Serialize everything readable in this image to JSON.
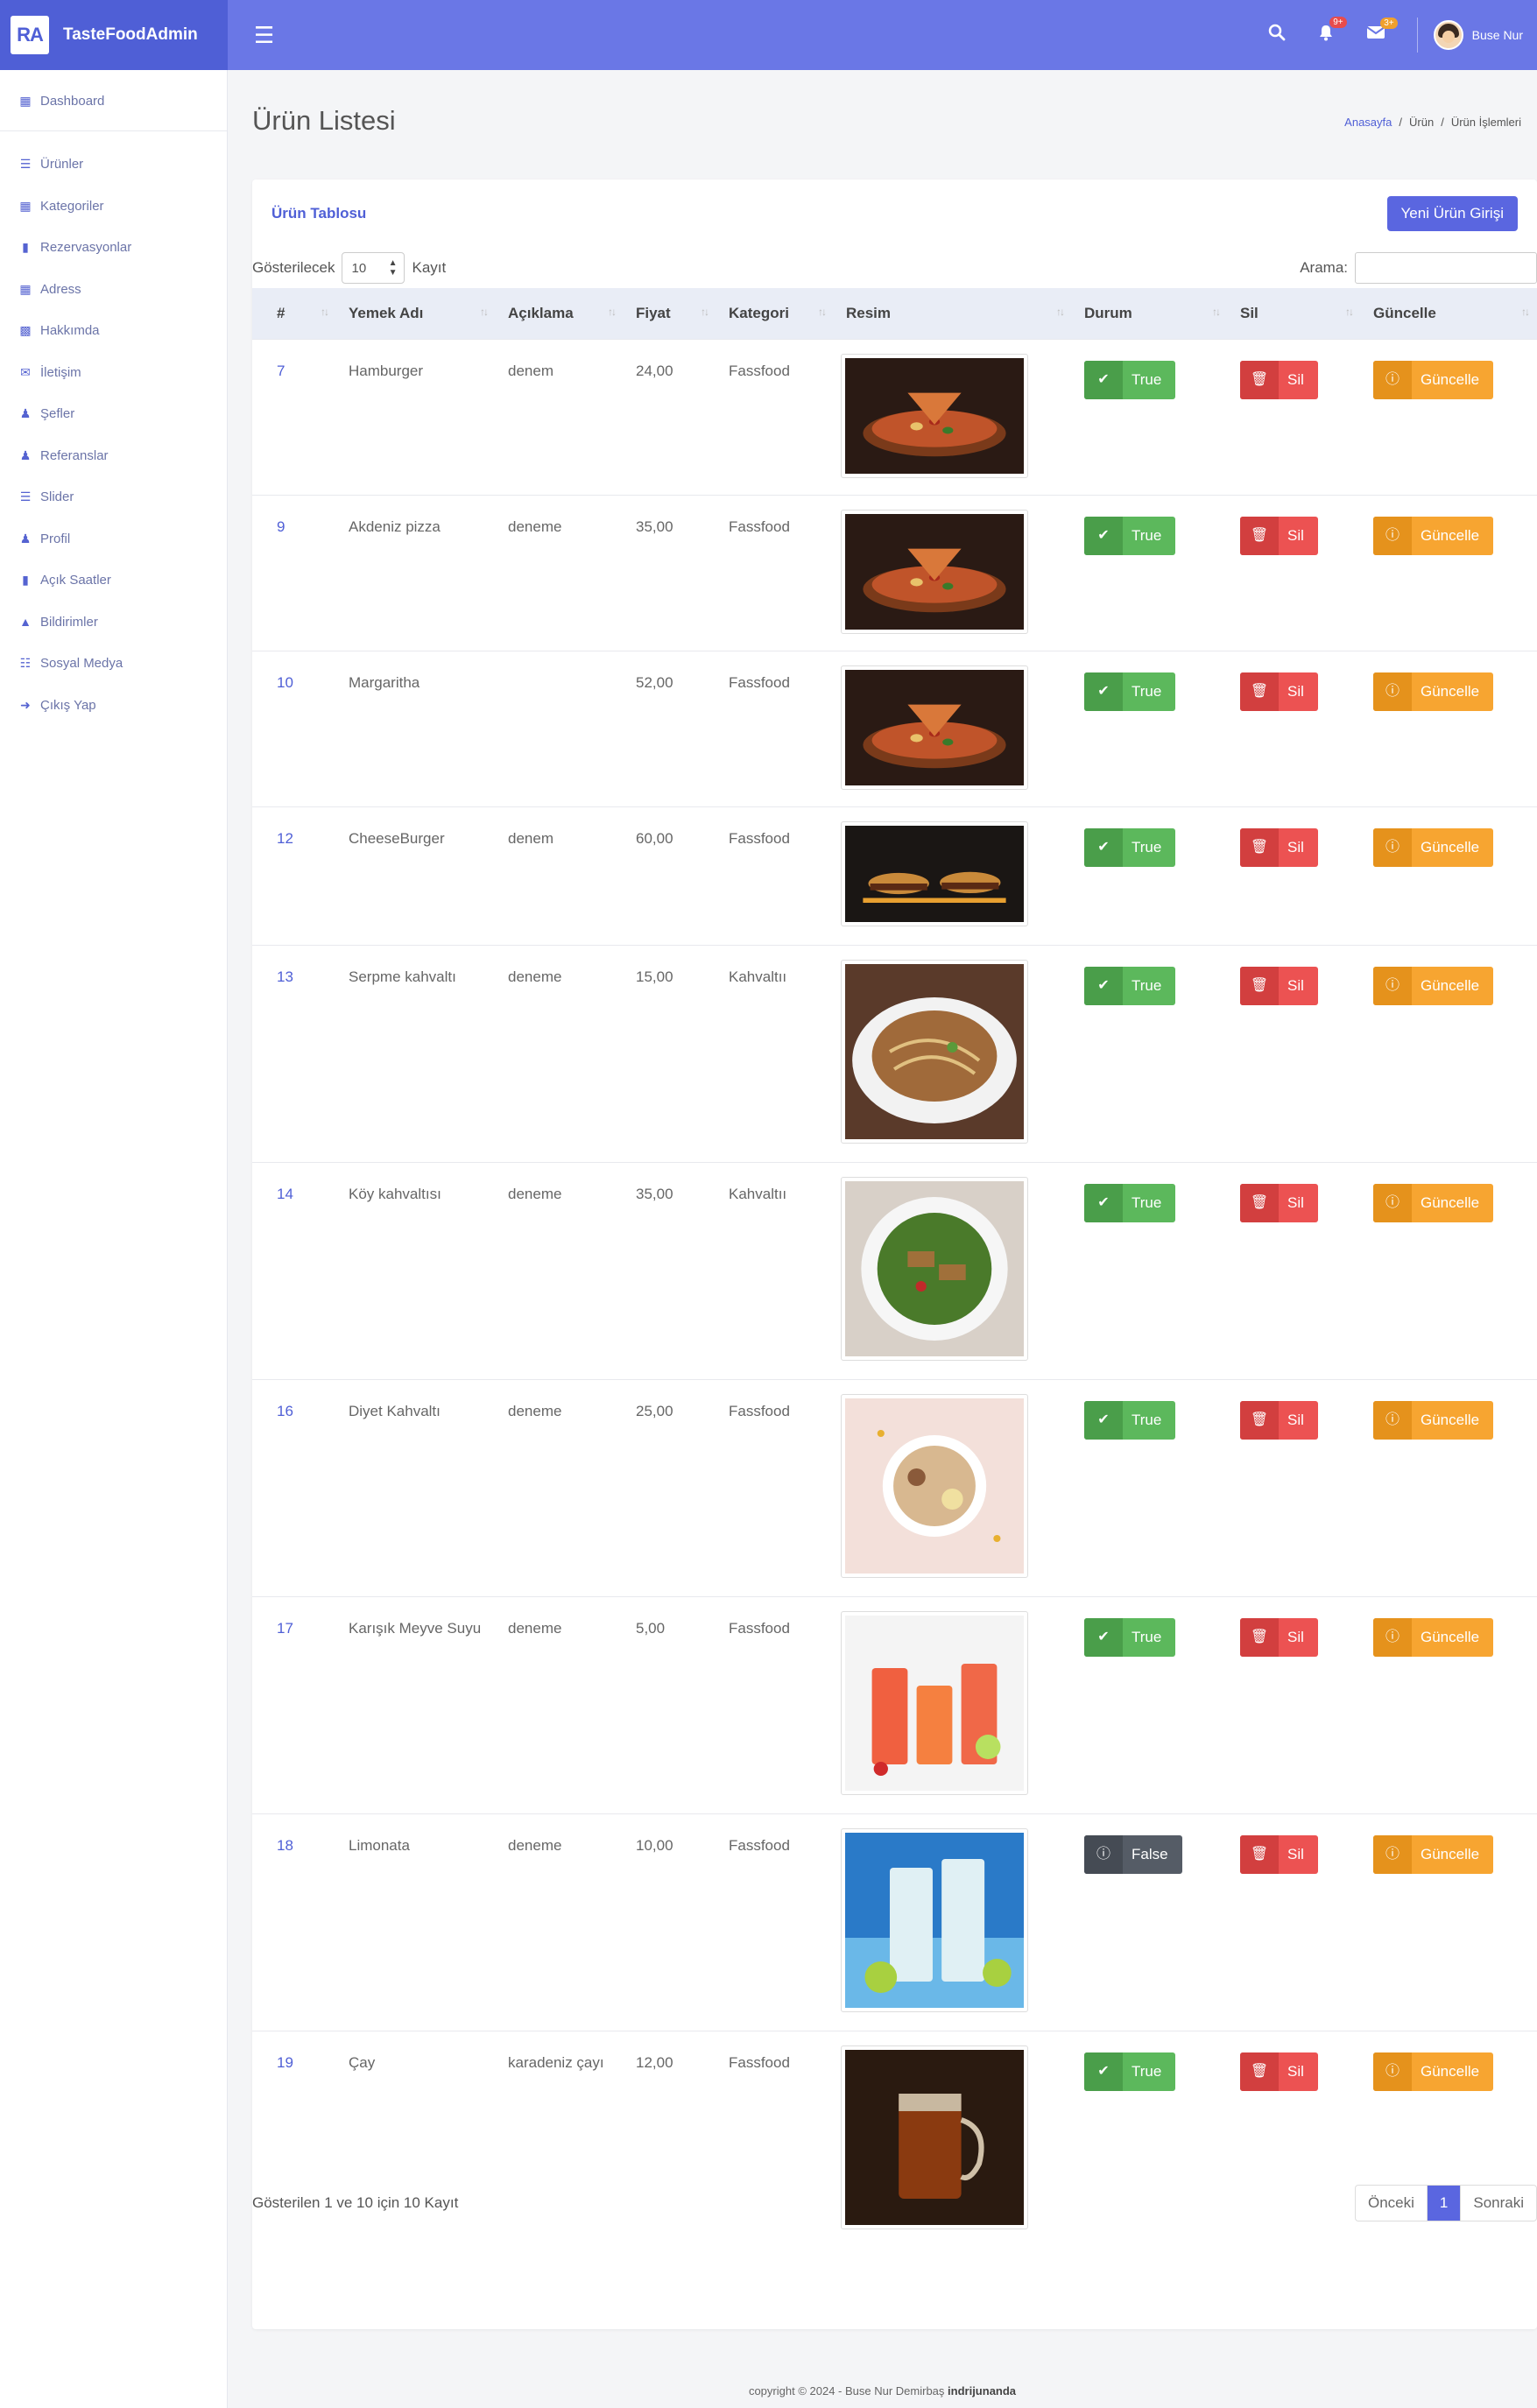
{
  "app": {
    "logo_text": "RA",
    "name": "TasteFoodAdmin",
    "user_name": "Buse Nur",
    "notification_badge": "9+",
    "message_badge": "3+"
  },
  "sidebar": {
    "items": [
      {
        "label": "Dashboard",
        "icon": "table-icon"
      },
      {
        "label": "Ürünler",
        "icon": "list-icon"
      },
      {
        "label": "Kategoriler",
        "icon": "table-icon"
      },
      {
        "label": "Rezervasyonlar",
        "icon": "clipboard-icon"
      },
      {
        "label": "Adress",
        "icon": "table-icon"
      },
      {
        "label": "Hakkımda",
        "icon": "book-icon"
      },
      {
        "label": "İletişim",
        "icon": "envelope-icon"
      },
      {
        "label": "Şefler",
        "icon": "users-icon"
      },
      {
        "label": "Referanslar",
        "icon": "users-icon"
      },
      {
        "label": "Slider",
        "icon": "bars-icon"
      },
      {
        "label": "Profil",
        "icon": "users-icon"
      },
      {
        "label": "Açık Saatler",
        "icon": "clipboard-check-icon"
      },
      {
        "label": "Bildirimler",
        "icon": "bell-icon"
      },
      {
        "label": "Sosyal Medya",
        "icon": "sitemap-icon"
      },
      {
        "label": "Çıkış Yap",
        "icon": "sign-out-icon"
      }
    ]
  },
  "page": {
    "title": "Ürün Listesi",
    "breadcrumb": [
      "Anasayfa",
      "Ürün",
      "Ürün İşlemleri"
    ]
  },
  "card": {
    "title": "Ürün Tablosu",
    "new_button": "Yeni Ürün Girişi"
  },
  "table_tools": {
    "show_label": "Gösterilecek",
    "page_size": "10",
    "records_label": "Kayıt",
    "search_label": "Arama:"
  },
  "table": {
    "columns": [
      "#",
      "Yemek Adı",
      "Açıklama",
      "Fiyat",
      "Kategori",
      "Resim",
      "Durum",
      "Sil",
      "Güncelle"
    ],
    "delete_label": "Sil",
    "update_label": "Güncelle",
    "rows": [
      {
        "id": "7",
        "name": "Hamburger",
        "desc": "denem",
        "price": "24,00",
        "category": "Fassfood",
        "status": "True",
        "image": "pizza-image"
      },
      {
        "id": "9",
        "name": "Akdeniz pizza",
        "desc": "deneme",
        "price": "35,00",
        "category": "Fassfood",
        "status": "True",
        "image": "pizza-image"
      },
      {
        "id": "10",
        "name": "Margaritha",
        "desc": "",
        "price": "52,00",
        "category": "Fassfood",
        "status": "True",
        "image": "pizza-image"
      },
      {
        "id": "12",
        "name": "CheeseBurger",
        "desc": "denem",
        "price": "60,00",
        "category": "Fassfood",
        "status": "True",
        "image": "burger-image"
      },
      {
        "id": "13",
        "name": "Serpme kahvaltı",
        "desc": "deneme",
        "price": "15,00",
        "category": "Kahvaltıı",
        "status": "True",
        "image": "noodle-plate-image"
      },
      {
        "id": "14",
        "name": "Köy kahvaltısı",
        "desc": "deneme",
        "price": "35,00",
        "category": "Kahvaltıı",
        "status": "True",
        "image": "salad-bowl-image"
      },
      {
        "id": "16",
        "name": "Diyet Kahvaltı",
        "desc": "deneme",
        "price": "25,00",
        "category": "Fassfood",
        "status": "True",
        "image": "oat-bowl-image"
      },
      {
        "id": "17",
        "name": "Karışık Meyve Suyu",
        "desc": "deneme",
        "price": "5,00",
        "category": "Fassfood",
        "status": "True",
        "image": "juice-image"
      },
      {
        "id": "18",
        "name": "Limonata",
        "desc": "deneme",
        "price": "10,00",
        "category": "Fassfood",
        "status": "False",
        "image": "lemonade-image"
      },
      {
        "id": "19",
        "name": "Çay",
        "desc": "karadeniz çayı",
        "price": "12,00",
        "category": "Fassfood",
        "status": "True",
        "image": "tea-image"
      }
    ]
  },
  "footer": {
    "info": "Gösterilen 1 ve 10 için 10 Kayıt",
    "pager": [
      "Önceki",
      "1",
      "Sonraki"
    ],
    "copyright": "copyright © 2024 - Buse Nur Demirbaş",
    "copyright_brand": "indrijunanda"
  },
  "colors": {
    "primary": "#6a77e6",
    "true_btn": "#5cb85c",
    "false_btn": "#555c66",
    "delete_btn": "#ec5252",
    "update_btn": "#f7a531"
  }
}
